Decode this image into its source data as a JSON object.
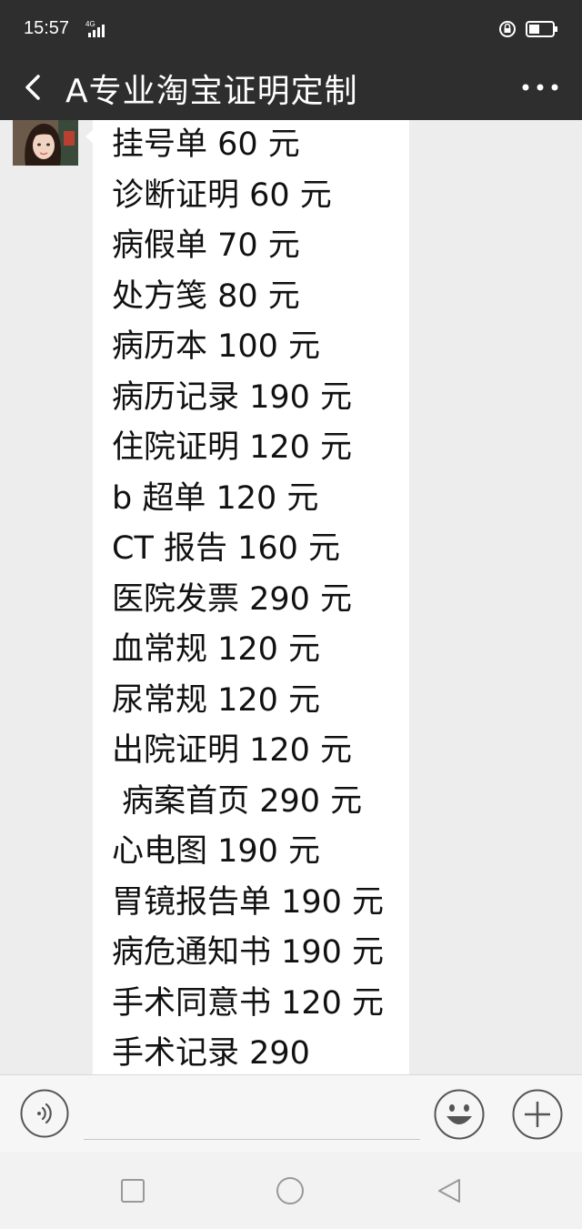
{
  "status_bar": {
    "time": "15:57",
    "network": "4G",
    "icons": [
      "signal-icon",
      "alarm-lock-icon",
      "battery-icon"
    ]
  },
  "header": {
    "title": "A专业淘宝证明定制",
    "back_icon": "chevron-left-icon",
    "more_icon": "more-dots-icon"
  },
  "message": {
    "lines": [
      "挂号单 60 元",
      "诊断证明 60 元",
      "病假单 70 元",
      "处方笺 80 元",
      "病历本 100 元",
      "病历记录 190 元",
      "住院证明 120 元",
      "b 超单 120 元",
      "CT 报告 160 元",
      "医院发票 290 元",
      "血常规 120 元",
      "尿常规 120 元",
      "出院证明 120 元",
      " 病案首页 290 元",
      "心电图 190 元",
      "胃镜报告单 190 元",
      "病危通知书 190 元",
      "手术同意书 120 元",
      "手术记录 290"
    ]
  },
  "input_bar": {
    "icons": [
      "voice-icon",
      "emoji-icon",
      "plus-icon"
    ]
  },
  "system_nav": {
    "icons": [
      "recents-square-icon",
      "home-circle-icon",
      "back-triangle-icon"
    ]
  },
  "colors": {
    "bar": "#2e2e2e",
    "chat_bg": "#ededed",
    "bubble": "#ffffff",
    "text": "#111111"
  }
}
